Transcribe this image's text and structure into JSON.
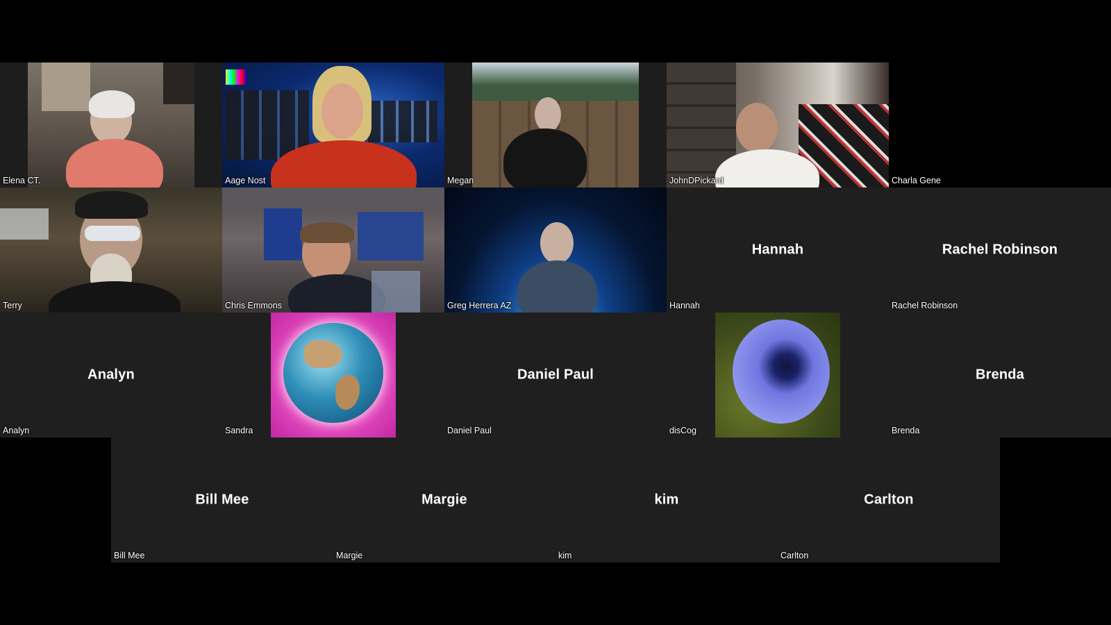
{
  "meeting": {
    "participants": [
      {
        "display": "Elena CT.",
        "label": "Elena CT.",
        "video": true
      },
      {
        "display": "Aage Nost",
        "label": "Aage Nost",
        "video": true
      },
      {
        "display": "Megan",
        "label": "Megan",
        "video": true
      },
      {
        "display": "JohnDPickard",
        "label": "JohnDPickard",
        "video": true
      },
      {
        "display": "Charla Gene",
        "label": "Charla Gene",
        "video": false,
        "center": ""
      },
      {
        "display": "Terry",
        "label": "Terry",
        "video": true
      },
      {
        "display": "Chris Emmons",
        "label": "Chris Emmons",
        "video": true
      },
      {
        "display": "Greg Herrera AZ",
        "label": "Greg Herrera AZ",
        "video": true
      },
      {
        "display": "Hannah",
        "label": "Hannah",
        "video": false,
        "center": "Hannah"
      },
      {
        "display": "Rachel Robinson",
        "label": "Rachel Robinson",
        "video": false,
        "center": "Rachel Robinson"
      },
      {
        "display": "Analyn",
        "label": "Analyn",
        "video": false,
        "center": "Analyn"
      },
      {
        "display": "Sandra",
        "label": "Sandra",
        "video": false,
        "picture": "earth-globe"
      },
      {
        "display": "Daniel Paul",
        "label": "Daniel Paul",
        "video": false,
        "center": "Daniel Paul"
      },
      {
        "display": "disCog",
        "label": "disCog",
        "video": false,
        "picture": "blue-flower"
      },
      {
        "display": "Brenda",
        "label": "Brenda",
        "video": false,
        "center": "Brenda"
      },
      {
        "display": "Bill Mee",
        "label": "Bill Mee",
        "video": false,
        "center": "Bill Mee"
      },
      {
        "display": "Margie",
        "label": "Margie",
        "video": false,
        "center": "Margie"
      },
      {
        "display": "kim",
        "label": "kim",
        "video": false,
        "center": "kim"
      },
      {
        "display": "Carlton",
        "label": "Carlton",
        "video": false,
        "center": "Carlton"
      }
    ]
  },
  "colors": {
    "background": "#000000",
    "tile": "#1f1f1f",
    "text": "#ffffff"
  },
  "icons": {
    "sandra_picture": "earth-globe-icon",
    "discog_picture": "blue-flower-icon"
  }
}
